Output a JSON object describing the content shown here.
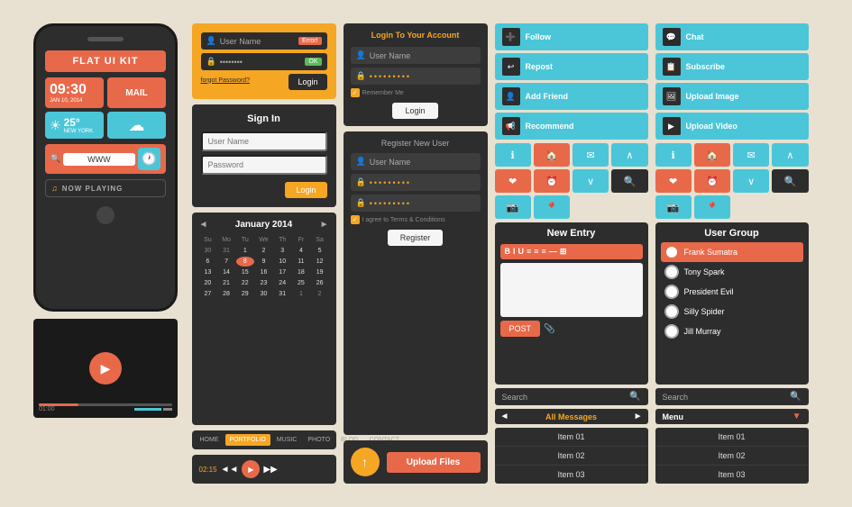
{
  "app": {
    "title": "Flat UI Kit"
  },
  "phone": {
    "header_label": "FLAT UI KIT",
    "time": "09:30",
    "date": "JAN 10, 2014",
    "mail_label": "MAIL",
    "temperature": "25°",
    "location": "NEW YORK",
    "search_label": "WWW",
    "music_label": "NOW PLAYING"
  },
  "video_player": {
    "time_start": "01:00",
    "time_end": "●●●"
  },
  "login_form": {
    "username_placeholder": "User Name",
    "password_placeholder": "••••••••",
    "error_label": "Error!",
    "ok_label": "OK",
    "forgot_label": "forgot Password?",
    "login_btn": "Login"
  },
  "sign_in": {
    "title": "Sign In",
    "username_placeholder": "User Name",
    "password_placeholder": "Password",
    "login_btn": "Login"
  },
  "calendar": {
    "title": "January 2014",
    "days_of_week": [
      "Su",
      "Mo",
      "Tu",
      "We",
      "Th",
      "Fr",
      "Sa"
    ],
    "weeks": [
      [
        "30",
        "31",
        "1",
        "2",
        "3",
        "4",
        "5"
      ],
      [
        "6",
        "7",
        "8",
        "9",
        "10",
        "11",
        "12"
      ],
      [
        "13",
        "14",
        "15",
        "16",
        "17",
        "18",
        "19"
      ],
      [
        "20",
        "21",
        "22",
        "23",
        "24",
        "25",
        "26"
      ],
      [
        "27",
        "28",
        "29",
        "30",
        "31",
        "1",
        "2"
      ]
    ],
    "today": "8",
    "prev_btn": "◄",
    "next_btn": "►"
  },
  "navbar": {
    "items": [
      {
        "label": "HOME",
        "active": false
      },
      {
        "label": "PORTFOLIO",
        "active": true
      },
      {
        "label": "MUSIC",
        "active": false
      },
      {
        "label": "PHOTO",
        "active": false
      },
      {
        "label": "BLOG",
        "active": false
      },
      {
        "label": "CONTACT",
        "active": false
      }
    ]
  },
  "media_controls": {
    "time": "02:15",
    "prev_btn": "◄◄",
    "play_btn": "▶",
    "next_btn": "▶▶"
  },
  "login_account": {
    "title": "Login To Your Account",
    "username_placeholder": "User Name",
    "password_dots": "•••••••••",
    "remember_label": "Remember Me",
    "login_btn": "Login"
  },
  "register": {
    "title": "Register New User",
    "username_placeholder": "User Name",
    "password_dots1": "•••••••••",
    "password_dots2": "•••••••••",
    "terms_label": "I agree to Terms & Conditions",
    "register_btn": "Register"
  },
  "upload": {
    "upload_btn": "Upload Files"
  },
  "social_buttons_left": [
    {
      "label": "Follow",
      "icon": "➕"
    },
    {
      "label": "Repost",
      "icon": "↩"
    },
    {
      "label": "Add Friend",
      "icon": "👤"
    },
    {
      "label": "Recommend",
      "icon": "📢"
    }
  ],
  "icon_grid_left": [
    "ℹ",
    "🏠",
    "✉",
    "∧",
    "❤",
    "⏰",
    "∨",
    "🔍",
    "📷",
    "📍"
  ],
  "new_entry": {
    "title": "New Entry",
    "toolbar_btns": [
      "B",
      "I",
      "U",
      "≡",
      "≡",
      "≡",
      "—",
      "⊞"
    ],
    "post_btn": "POST"
  },
  "search_left": {
    "label": "Search",
    "icon": "🔍"
  },
  "messages": {
    "prev_btn": "◄",
    "label": "All Messages",
    "next_btn": "►",
    "items": [
      "Item 01",
      "Item 02",
      "Item 03"
    ]
  },
  "social_buttons_right": [
    {
      "label": "Chat",
      "icon": "💬"
    },
    {
      "label": "Subscribe",
      "icon": "📋"
    },
    {
      "label": "Upload Image",
      "icon": "🖼"
    },
    {
      "label": "Upload Video",
      "icon": "▶"
    }
  ],
  "user_group": {
    "title": "User Group",
    "users": [
      {
        "name": "Frank Sumatra",
        "highlighted": true
      },
      {
        "name": "Tony Spark",
        "highlighted": false
      },
      {
        "name": "President Evil",
        "highlighted": false
      },
      {
        "name": "Silly Spider",
        "highlighted": false
      },
      {
        "name": "Jill Murray",
        "highlighted": false
      }
    ]
  },
  "search_right": {
    "label": "Search",
    "icon": "🔍"
  },
  "menu": {
    "title": "Menu",
    "arrow": "▼",
    "items": [
      "Item 01",
      "Item 02",
      "Item 03"
    ]
  }
}
